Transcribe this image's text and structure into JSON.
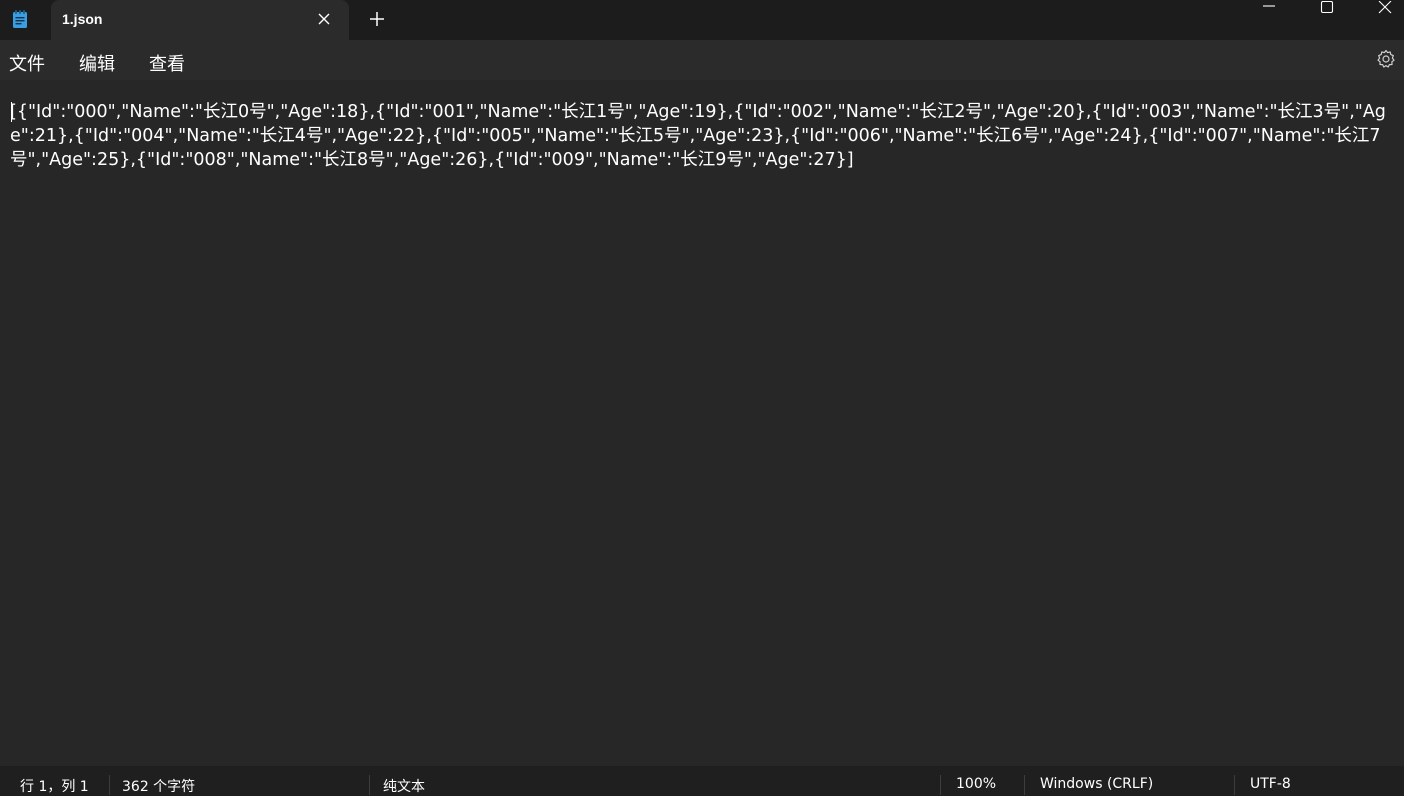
{
  "window": {
    "tab_title": "1.json"
  },
  "menu": {
    "items": [
      "文件",
      "编辑",
      "查看"
    ]
  },
  "icons": {
    "app": "notepad-icon",
    "tab_close": "close-icon",
    "new_tab": "plus-icon",
    "minimize": "minimize-icon",
    "maximize": "maximize-icon",
    "close_window": "close-window-icon",
    "settings": "gear-icon"
  },
  "editor": {
    "content": "[{\"Id\":\"000\",\"Name\":\"长江0号\",\"Age\":18},{\"Id\":\"001\",\"Name\":\"长江1号\",\"Age\":19},{\"Id\":\"002\",\"Name\":\"长江2号\",\"Age\":20},{\"Id\":\"003\",\"Name\":\"长江3号\",\"Age\":21},{\"Id\":\"004\",\"Name\":\"长江4号\",\"Age\":22},{\"Id\":\"005\",\"Name\":\"长江5号\",\"Age\":23},{\"Id\":\"006\",\"Name\":\"长江6号\",\"Age\":24},{\"Id\":\"007\",\"Name\":\"长江7号\",\"Age\":25},{\"Id\":\"008\",\"Name\":\"长江8号\",\"Age\":26},{\"Id\":\"009\",\"Name\":\"长江9号\",\"Age\":27}]"
  },
  "status": {
    "position": "行 1，列 1",
    "char_count": "362 个字符",
    "format": "纯文本",
    "zoom": "100%",
    "line_ending": "Windows (CRLF)",
    "encoding": "UTF-8"
  },
  "colors": {
    "titlebar_bg": "#1c1c1c",
    "tab_bg": "#2b2b2b",
    "editor_bg": "#272727",
    "statusbar_bg": "#1f1f1f",
    "app_icon_blue": "#3a9ee0"
  }
}
